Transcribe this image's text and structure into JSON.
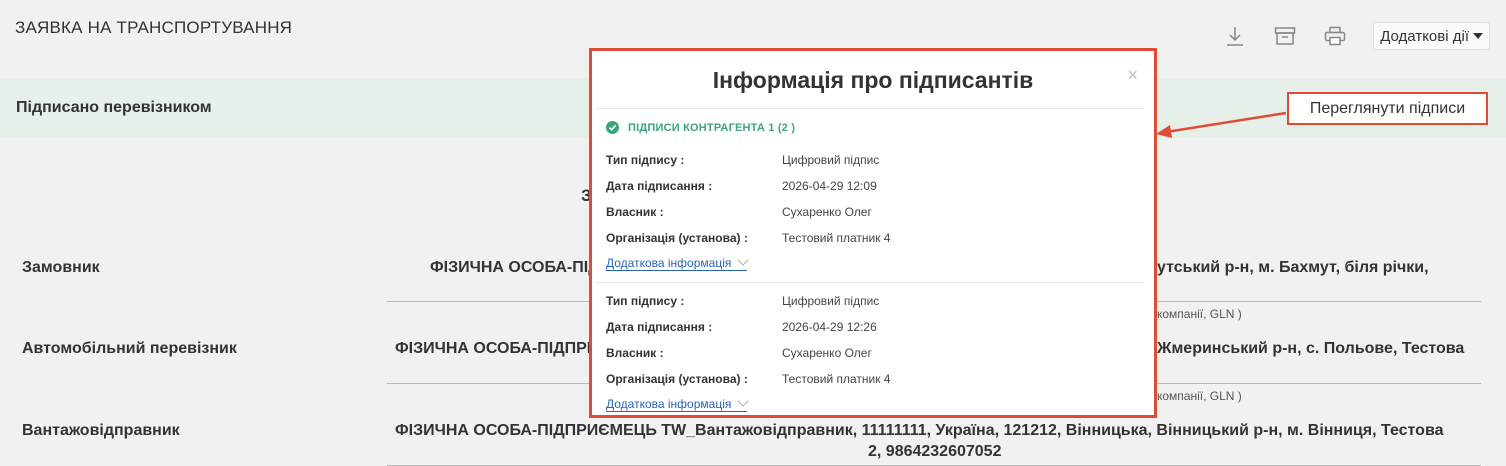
{
  "header": {
    "title": "ЗАЯВКА НА ТРАНСПОРТУВАННЯ",
    "more_actions_label": "Додаткові дії"
  },
  "status": {
    "text": "Підписано перевізником",
    "view_signatures_label": "Переглянути підписи"
  },
  "document": {
    "heading_partial": "З",
    "rows": [
      {
        "label": "Замовник",
        "value_left": "ФІЗИЧНА ОСОБА-ПІД",
        "value_right": "утський р-н, м. Бахмут, біля річки,",
        "sub_right": "компанії, GLN )"
      },
      {
        "label": "Автомобільний перевізник",
        "value_left": "ФІЗИЧНА ОСОБА-ПІДПРИ",
        "value_right": "Жмеринський р-н, с. Польове, Тестова",
        "sub_right": "компанії, GLN )"
      },
      {
        "label": "Вантажовідправник",
        "value_line1": "ФІЗИЧНА ОСОБА-ПІДПРИЄМЕЦЬ TW_Вантажовідправник, 11111111, Україна, 121212, Вінницька, Вінницький р-н, м. Вінниця, Тестова",
        "value_line2": "2, 9864232607052"
      }
    ]
  },
  "modal": {
    "title": "Інформація про підписантів",
    "close": "×",
    "section_title": "ПІДПИСИ КОНТРАГЕНТА 1 (2 )",
    "labels": {
      "type": "Тип підпису :",
      "date": "Дата підписання :",
      "owner": "Власник :",
      "org": "Організація (установа) :"
    },
    "more_info_label": "Додаткова інформація",
    "signatures": [
      {
        "type": "Цифровий підпис",
        "date": "2026-04-29 12:09",
        "owner": "Сухаренко Олег",
        "org": "Тестовий платник 4"
      },
      {
        "type": "Цифровий підпис",
        "date": "2026-04-29 12:26",
        "owner": "Сухаренко Олег",
        "org": "Тестовий платник 4"
      }
    ]
  },
  "colors": {
    "accent_red": "#e04b34",
    "success_green": "#3aa57a",
    "link_blue": "#2a64b4",
    "status_bg": "#e6efe8"
  },
  "icons": [
    "download-icon",
    "archive-icon",
    "print-icon",
    "caret-down-icon",
    "close-icon",
    "check-circle-icon",
    "chevron-down-icon"
  ]
}
